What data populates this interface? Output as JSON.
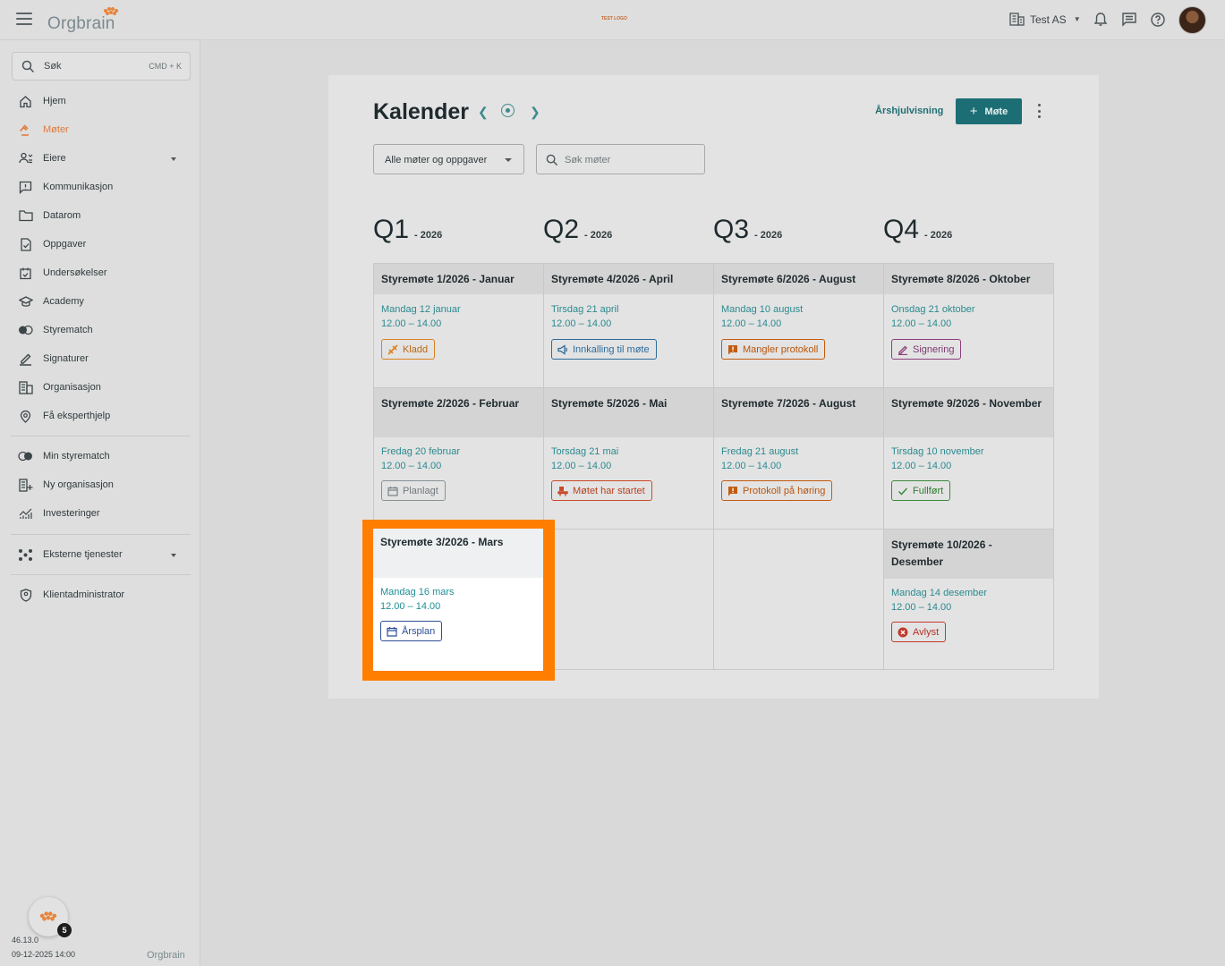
{
  "topbar": {
    "logo": "Orgbrain",
    "test_logo": "TEST LOGO",
    "org_name": "Test AS"
  },
  "sidebar": {
    "search_label": "Søk",
    "search_shortcut": "CMD + K",
    "items": [
      {
        "label": "Hjem",
        "icon": "home-icon"
      },
      {
        "label": "Møter",
        "icon": "gavel-icon",
        "active": true
      },
      {
        "label": "Eiere",
        "icon": "owners-icon",
        "expandable": true
      },
      {
        "label": "Kommunikasjon",
        "icon": "message-icon"
      },
      {
        "label": "Datarom",
        "icon": "folder-icon"
      },
      {
        "label": "Oppgaver",
        "icon": "task-icon"
      },
      {
        "label": "Undersøkelser",
        "icon": "survey-icon"
      },
      {
        "label": "Academy",
        "icon": "academy-icon"
      },
      {
        "label": "Styrematch",
        "icon": "styrematch-icon"
      },
      {
        "label": "Signaturer",
        "icon": "signature-icon"
      },
      {
        "label": "Organisasjon",
        "icon": "organization-icon"
      },
      {
        "label": "Få eksperthjelp",
        "icon": "expert-help-icon"
      }
    ],
    "secondary_items": [
      {
        "label": "Min styrematch",
        "icon": "styrematch-icon"
      },
      {
        "label": "Ny organisasjon",
        "icon": "new-organization-icon"
      },
      {
        "label": "Investeringer",
        "icon": "investments-icon"
      }
    ],
    "external_services": "Eksterne tjenester",
    "client_admin": "Klientadministrator",
    "notification_count": "5",
    "version": "46.13.0",
    "build_date": "09-12-2025 14:00",
    "footer_logo": "Orgbrain"
  },
  "calendar": {
    "title": "Kalender",
    "year_view_label": "Årshjulvisning",
    "add_meeting_label": "Møte",
    "filter_value": "Alle møter og oppgaver",
    "search_placeholder": "Søk møter",
    "quarters": [
      {
        "label": "Q1",
        "year": "- 2026"
      },
      {
        "label": "Q2",
        "year": "- 2026"
      },
      {
        "label": "Q3",
        "year": "- 2026"
      },
      {
        "label": "Q4",
        "year": "- 2026"
      }
    ],
    "meetings": [
      {
        "title": "Styremøte 1/2026 - Januar",
        "date": "Mandag 12 januar",
        "time": "12.00 – 14.00",
        "status": "Kladd",
        "status_icon": "draft-icon",
        "status_color": "#d9831f"
      },
      {
        "title": "Styremøte 2/2026 - Februar",
        "date": "Fredag 20 februar",
        "time": "12.00 – 14.00",
        "status": "Planlagt",
        "status_icon": "calendar-icon",
        "status_color": "#8a9296"
      },
      {
        "title": "Styremøte 3/2026 - Mars",
        "date": "Mandag 16 mars",
        "time": "12.00 – 14.00",
        "status": "Årsplan",
        "status_icon": "calendar-icon",
        "status_color": "#2d4f97"
      },
      {
        "title": "Styremøte 4/2026 - April",
        "date": "Tirsdag 21 april",
        "time": "12.00 – 14.00",
        "status": "Innkalling til møte",
        "status_icon": "megaphone-icon",
        "status_color": "#2d6c9a"
      },
      {
        "title": "Styremøte 5/2026 - Mai",
        "date": "Torsdag 21 mai",
        "time": "12.00 – 14.00",
        "status": "Møtet har startet",
        "status_icon": "meeting-started-icon",
        "status_color": "#c94a28"
      },
      {
        "title": "Styremøte 6/2026 - August",
        "date": "Mandag 10 august",
        "time": "12.00 – 14.00",
        "status": "Mangler protokoll",
        "status_icon": "alert-comment-icon",
        "status_color": "#c25c10"
      },
      {
        "title": "Styremøte 7/2026 - August",
        "date": "Fredag 21 august",
        "time": "12.00 – 14.00",
        "status": "Protokoll på høring",
        "status_icon": "alert-comment-icon",
        "status_color": "#c25c10"
      },
      {
        "title": "Styremøte 8/2026 - Oktober",
        "date": "Onsdag 21 oktober",
        "time": "12.00 – 14.00",
        "status": "Signering",
        "status_icon": "pen-icon",
        "status_color": "#8a3f7a"
      },
      {
        "title": "Styremøte 9/2026 - November",
        "date": "Tirsdag 10 november",
        "time": "12.00 – 14.00",
        "status": "Fullført",
        "status_icon": "check-icon",
        "status_color": "#3c8a3c"
      },
      {
        "title": "Styremøte 10/2026 - Desember",
        "date": "Mandag 14 desember",
        "time": "12.00 – 14.00",
        "status": "Avlyst",
        "status_icon": "cancel-icon",
        "status_color": "#c23a2e"
      }
    ]
  }
}
